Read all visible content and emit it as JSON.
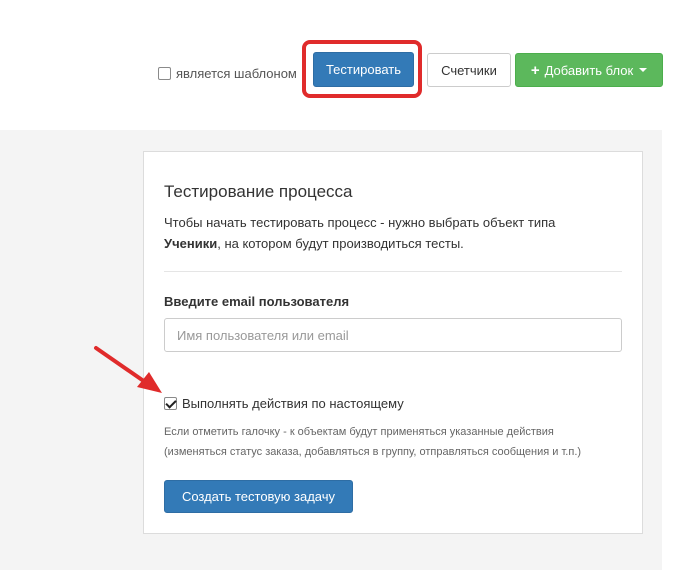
{
  "toolbar": {
    "template_label": "является шаблоном",
    "template_checked": false,
    "test_button": "Тестировать",
    "counters_button": "Счетчики",
    "add_block_button": "Добавить блок"
  },
  "panel": {
    "title": "Тестирование процесса",
    "desc_prefix": "Чтобы начать тестировать процесс - нужно выбрать объект типа ",
    "desc_bold": "Ученики",
    "desc_suffix": ", на котором будут производиться тесты.",
    "email_label": "Введите email пользователя",
    "email_placeholder": "Имя пользователя или email",
    "email_value": "",
    "real_actions_label": "Выполнять действия по настоящему",
    "real_actions_checked": true,
    "help_line1": "Если отметить галочку - к объектам будут применяться указанные действия",
    "help_line2": "(изменяться статус заказа, добавляться в группу, отправляться сообщения и т.п.)",
    "create_button": "Создать тестовую задачу"
  },
  "annotation": {
    "highlight_color": "#e02b2b",
    "arrow_color": "#e02b2b"
  }
}
